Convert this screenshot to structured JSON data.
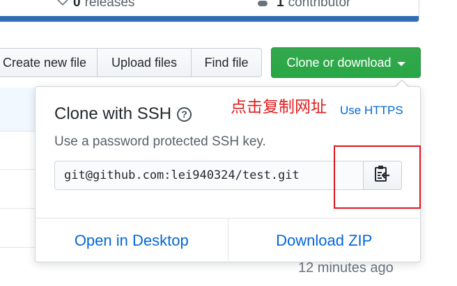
{
  "repo_stats": {
    "releases_count": "0",
    "releases_label": "releases",
    "contributors_count": "1",
    "contributors_label": "contributor"
  },
  "toolbar": {
    "create_new_file": "Create new file",
    "upload_files": "Upload files",
    "find_file": "Find file",
    "clone_or_download": "Clone or download"
  },
  "clone_panel": {
    "title": "Clone with SSH",
    "help_symbol": "?",
    "annotation": "点击复制网址",
    "use_https": "Use HTTPS",
    "description": "Use a password protected SSH key.",
    "url_value": "git@github.com:lei940324/test.git",
    "open_in_desktop": "Open in Desktop",
    "download_zip": "Download ZIP"
  },
  "background": {
    "last_updated": "12 minutes ago"
  },
  "colors": {
    "primary_green": "#28a745",
    "link_blue": "#0366d6",
    "annotation_red": "#e11c1c"
  }
}
